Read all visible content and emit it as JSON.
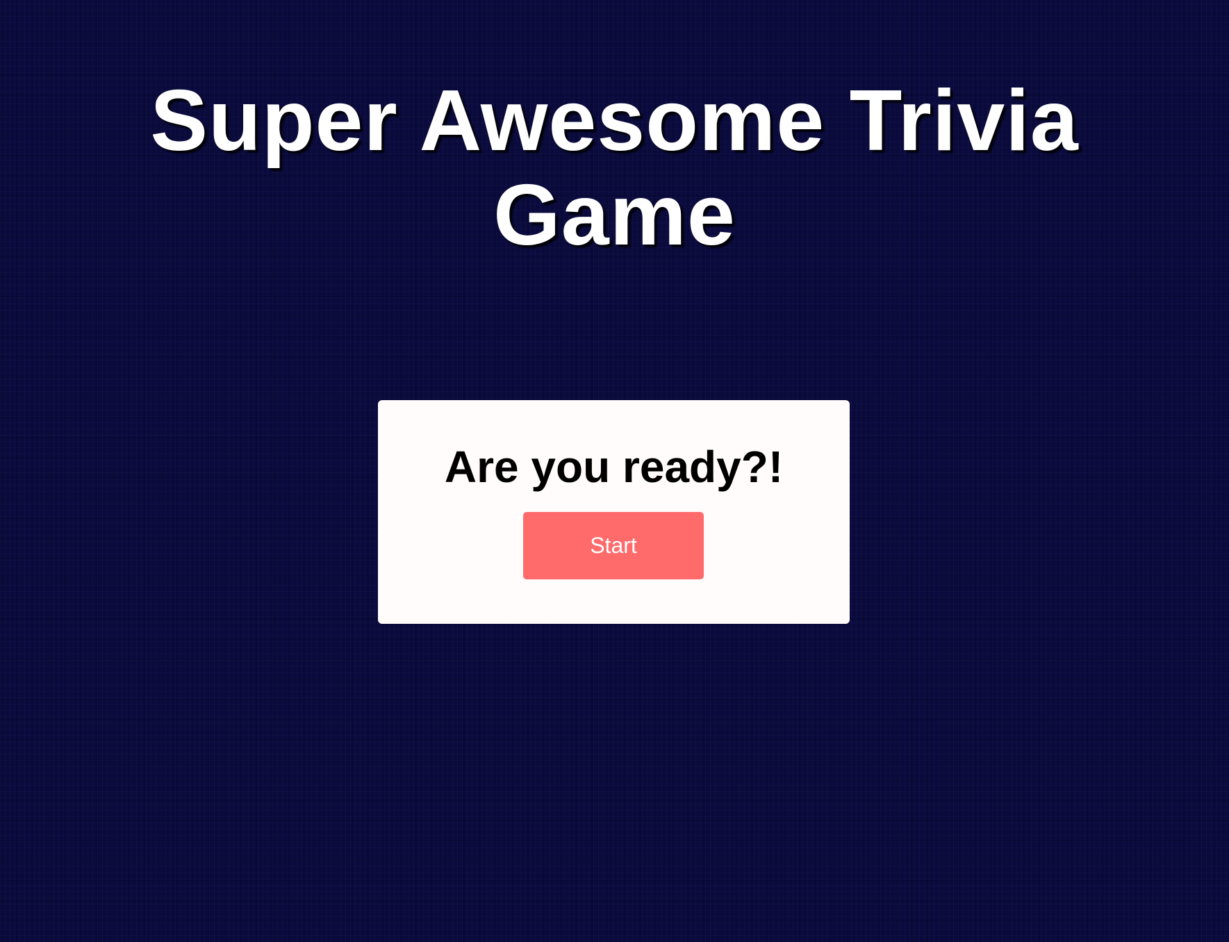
{
  "page": {
    "title_line1": "Super Awesome Trivia",
    "title_line2": "Game"
  },
  "start_card": {
    "heading": "Are you ready?!",
    "start_label": "Start"
  },
  "colors": {
    "background": "#0a0a3d",
    "card": "#fffcfb",
    "button": "#ff6a6b",
    "title_text": "#ffffff"
  }
}
